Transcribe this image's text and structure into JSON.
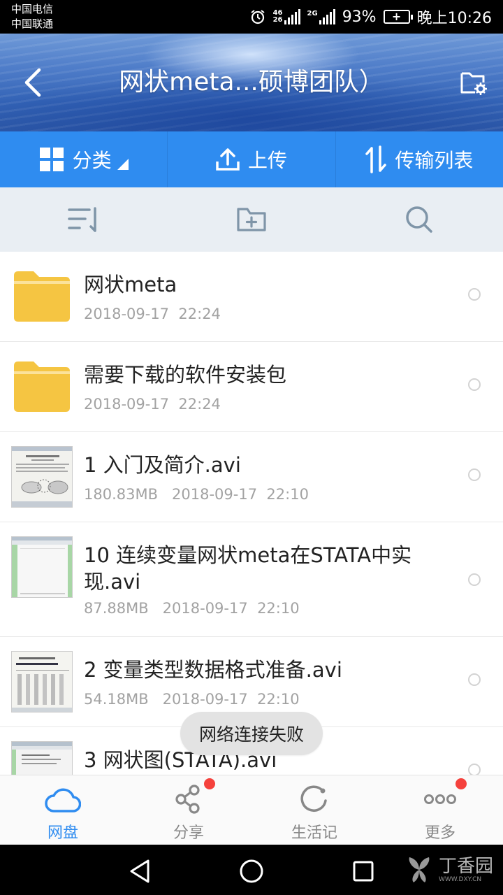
{
  "status_bar": {
    "carrier_1": "中国电信",
    "carrier_2": "中国联通",
    "network_1": "46",
    "network_2": "26",
    "battery_percent": "93%",
    "time": "晚上10:26"
  },
  "header": {
    "title": "网状meta...硕博团队）"
  },
  "toolbar": {
    "category": "分类",
    "upload": "上传",
    "transfer_list": "传输列表"
  },
  "files": [
    {
      "name": "网状meta",
      "meta": "2018-09-17  22:24",
      "type": "folder"
    },
    {
      "name": "需要下载的软件安装包",
      "meta": "2018-09-17  22:24",
      "type": "folder"
    },
    {
      "name": "1 入门及简介.avi",
      "meta": "180.83MB   2018-09-17  22:10",
      "type": "video"
    },
    {
      "name": "10 连续变量网状meta在STATA中实现.avi",
      "meta": "87.88MB   2018-09-17  22:10",
      "type": "video"
    },
    {
      "name": "2 变量类型数据格式准备.avi",
      "meta": "54.18MB   2018-09-17  22:10",
      "type": "video"
    },
    {
      "name": "3 网状图(STATA).avi",
      "meta": "",
      "type": "video"
    }
  ],
  "toast": "网络连接失败",
  "tabs": {
    "disk": "网盘",
    "share": "分享",
    "life": "生活记",
    "more": "更多"
  },
  "watermark": {
    "text": "丁香园",
    "url": "WWW.DXY.CN"
  },
  "colors": {
    "accent": "#2f8cf0",
    "folder": "#f5c542",
    "badge": "#f5413c"
  }
}
